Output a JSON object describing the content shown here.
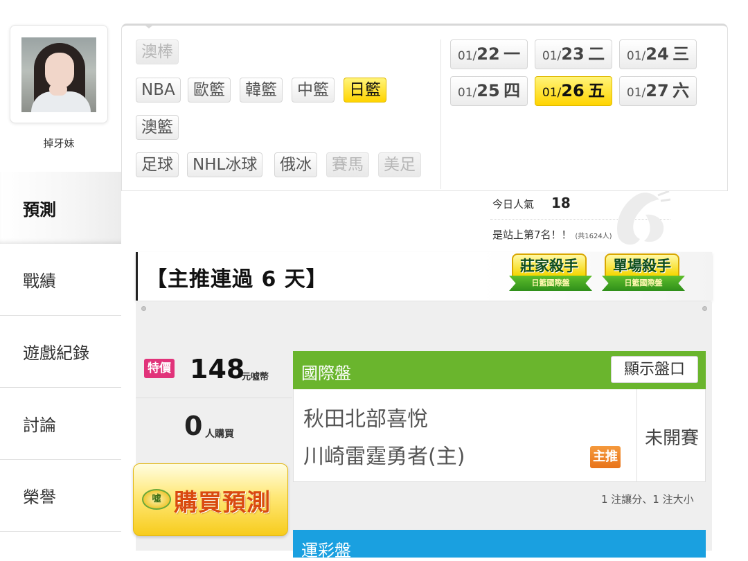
{
  "user": {
    "name": "掉牙妹"
  },
  "nav": {
    "items": [
      {
        "label": "預測",
        "active": true
      },
      {
        "label": "戰績"
      },
      {
        "label": "遊戲紀錄"
      },
      {
        "label": "討論"
      },
      {
        "label": "榮譽"
      }
    ]
  },
  "categories": {
    "row1": [
      {
        "label": "澳棒",
        "state": "disabled"
      }
    ],
    "row2": [
      {
        "label": "NBA"
      },
      {
        "label": "歐籃"
      },
      {
        "label": "韓籃"
      },
      {
        "label": "中籃"
      },
      {
        "label": "日籃",
        "state": "active"
      }
    ],
    "row3": [
      {
        "label": "澳籃"
      }
    ],
    "row4": [
      {
        "label": "足球"
      },
      {
        "label": "NHL冰球"
      },
      {
        "label": "俄冰"
      },
      {
        "label": "賽馬",
        "state": "disabled"
      },
      {
        "label": "美足",
        "state": "disabled"
      }
    ]
  },
  "dates": [
    {
      "month": "01/",
      "day": "22",
      "weekday": "一"
    },
    {
      "month": "01/",
      "day": "23",
      "weekday": "二"
    },
    {
      "month": "01/",
      "day": "24",
      "weekday": "三"
    },
    {
      "month": "01/",
      "day": "25",
      "weekday": "四"
    },
    {
      "month": "01/",
      "day": "26",
      "weekday": "五",
      "active": true
    },
    {
      "month": "01/",
      "day": "27",
      "weekday": "六"
    }
  ],
  "popularity": {
    "label": "今日人氣",
    "value": "18",
    "rank_text": "是站上第7名！！",
    "rank_total": "(共1624人)"
  },
  "headline": "【主推連過 6 天】",
  "badges": [
    {
      "title": "莊家殺手",
      "ribbon": "日籃國際盤"
    },
    {
      "title": "單場殺手",
      "ribbon": "日籃國際盤"
    }
  ],
  "product": {
    "price_tag": "特價",
    "price": "148",
    "price_unit": "元噓幣",
    "buyers": "0",
    "buyers_unit": "人購買",
    "buy_coin": "噓",
    "buy_label": "購買預測"
  },
  "game": {
    "section_title": "國際盤",
    "show_button": "顯示盤口",
    "team_away": "秋田北部喜悅",
    "team_home": "川崎雷霆勇者(主)",
    "main_tag": "主推",
    "status": "未開賽",
    "summary": "1 注讓分、1 注大小"
  },
  "lottery": {
    "section_title": "運彩盤"
  },
  "colors": {
    "highlight_yellow": "#ffd400",
    "green_header": "#6ab52d",
    "blue_header": "#1aa0e0",
    "price_pink": "#e1337a",
    "main_orange": "#e8731a"
  }
}
